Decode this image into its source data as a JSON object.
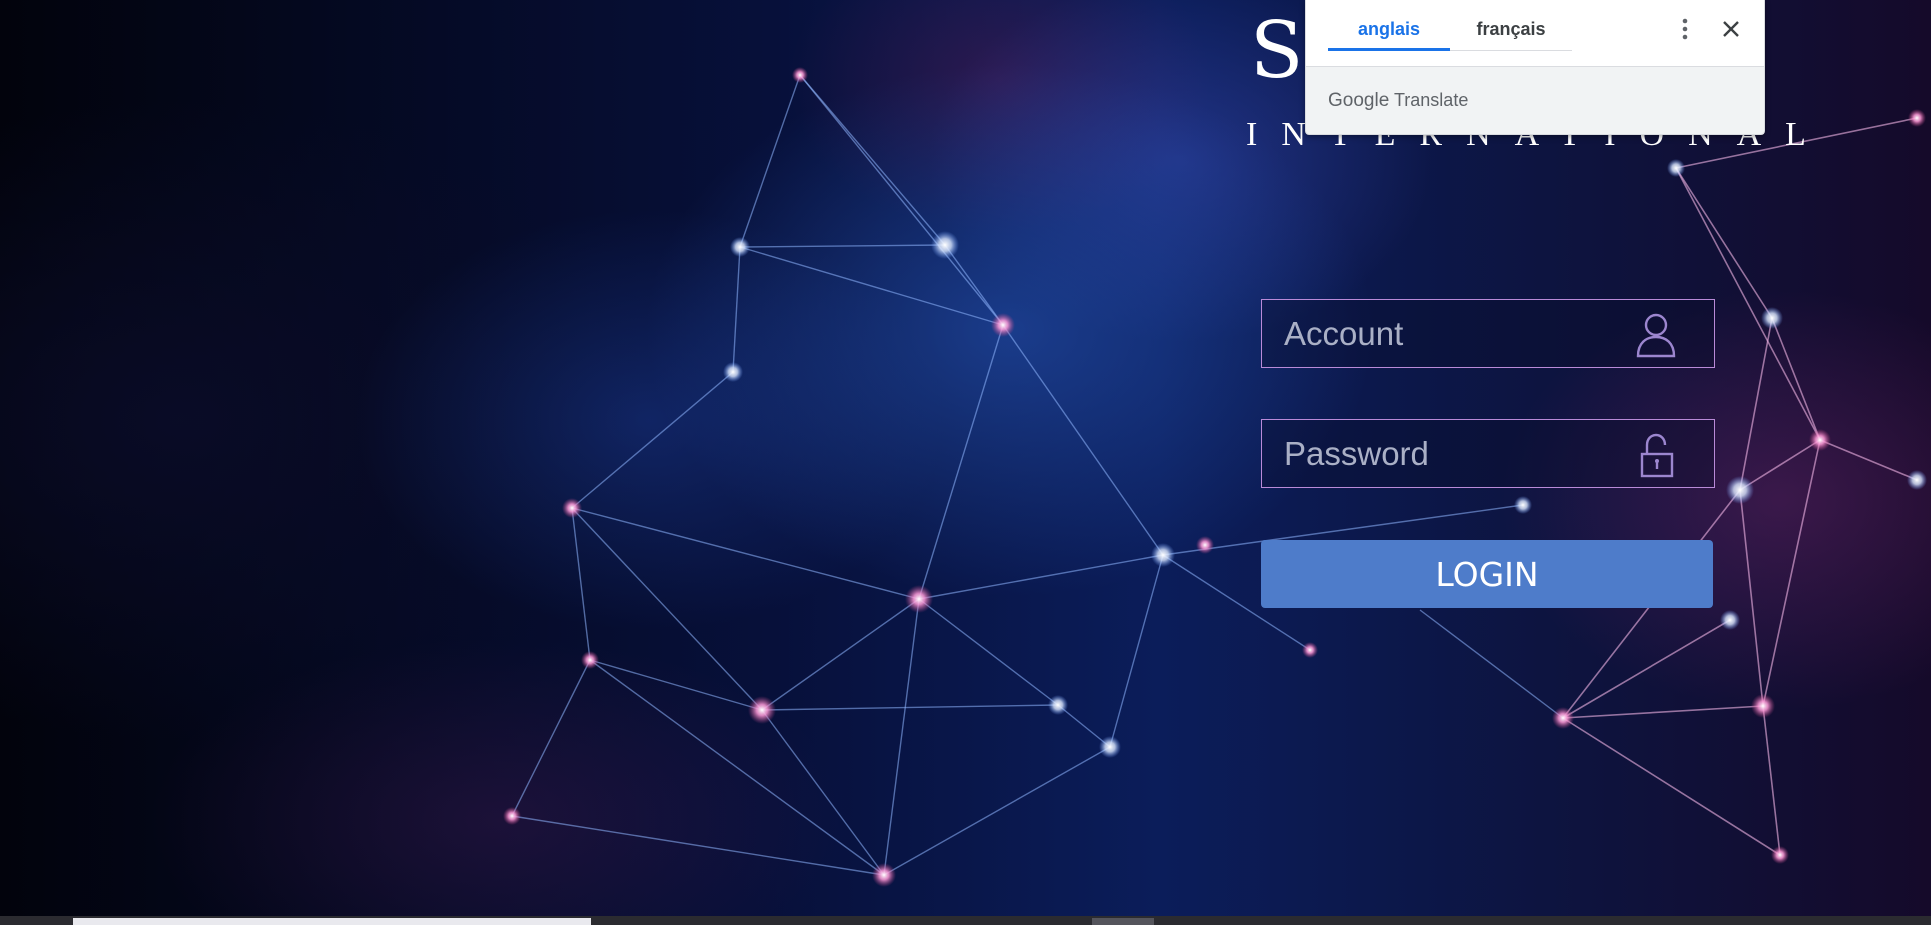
{
  "logo": {
    "main": "SA",
    "sub": "INTERNATIONAL"
  },
  "login": {
    "account_placeholder": "Account",
    "password_placeholder": "Password",
    "button_label": "LOGIN",
    "account_icon": "user-icon",
    "password_icon": "unlock-icon"
  },
  "translate_popup": {
    "tabs": [
      {
        "label": "anglais",
        "active": true
      },
      {
        "label": "français",
        "active": false
      }
    ],
    "brand_google": "Google",
    "brand_translate": "Translate",
    "menu_icon": "more-vert-icon",
    "close_icon": "close-icon"
  },
  "colors": {
    "accent_button": "#4e7cca",
    "field_border": "#b98ad8",
    "translate_active": "#1a73e8"
  }
}
